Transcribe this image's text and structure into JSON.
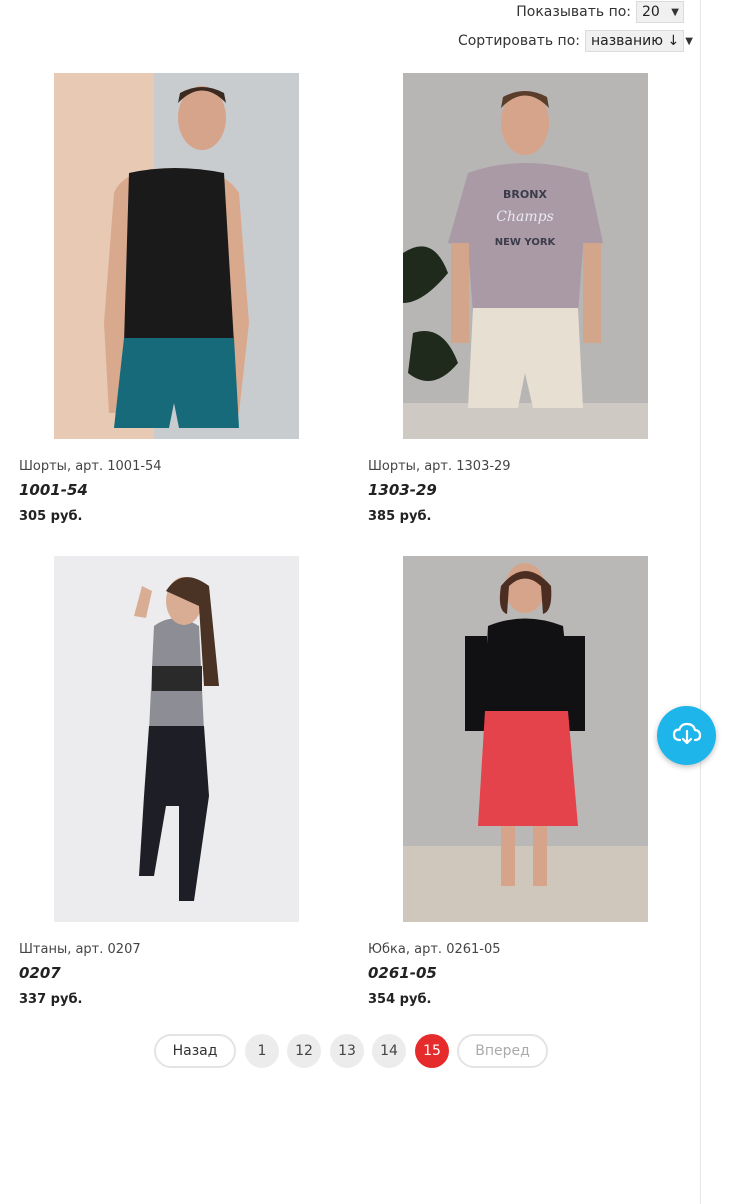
{
  "controls": {
    "per_page_label": "Показывать по:",
    "per_page_value": "20",
    "sort_label": "Сортировать по:",
    "sort_value": "названию ↓"
  },
  "products": [
    {
      "name": "Шорты, арт. 1001-54",
      "sku": "1001-54",
      "price": "305 руб."
    },
    {
      "name": "Шорты, арт. 1303-29",
      "sku": "1303-29",
      "price": "385 руб."
    },
    {
      "name": "Штаны, арт. 0207",
      "sku": "0207",
      "price": "337 руб."
    },
    {
      "name": "Юбка, арт. 0261-05",
      "sku": "0261-05",
      "price": "354 руб."
    }
  ],
  "pagination": {
    "prev": "Назад",
    "pages": [
      "1",
      "12",
      "13",
      "14",
      "15"
    ],
    "current": "15",
    "next": "Вперед"
  },
  "colors": {
    "accent_active_page": "#e52b2b",
    "fab": "#1eb6ea"
  },
  "fab_icon": "cloud-download-icon"
}
